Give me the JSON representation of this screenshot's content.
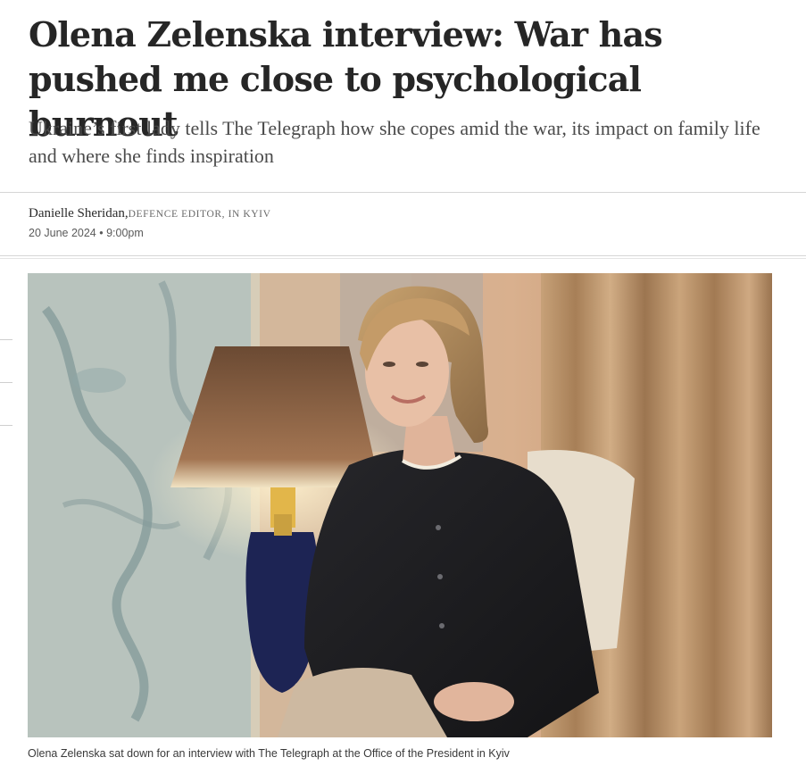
{
  "article": {
    "headline": "Olena Zelenska interview: War has pushed me close to psychological burnout",
    "standfirst": "Ukraine’s first lady tells The Telegraph how she copes amid the war, its impact on family life and where she finds inspiration",
    "author": "Danielle Sheridan,",
    "author_role": "DEFENCE EDITOR, IN KYIV",
    "date": "20 June 2024 • 9:00pm"
  },
  "image": {
    "caption": "Olena Zelenska sat down for an interview with The Telegraph at the Office of the President in Kyiv",
    "description_icon": "photo"
  }
}
